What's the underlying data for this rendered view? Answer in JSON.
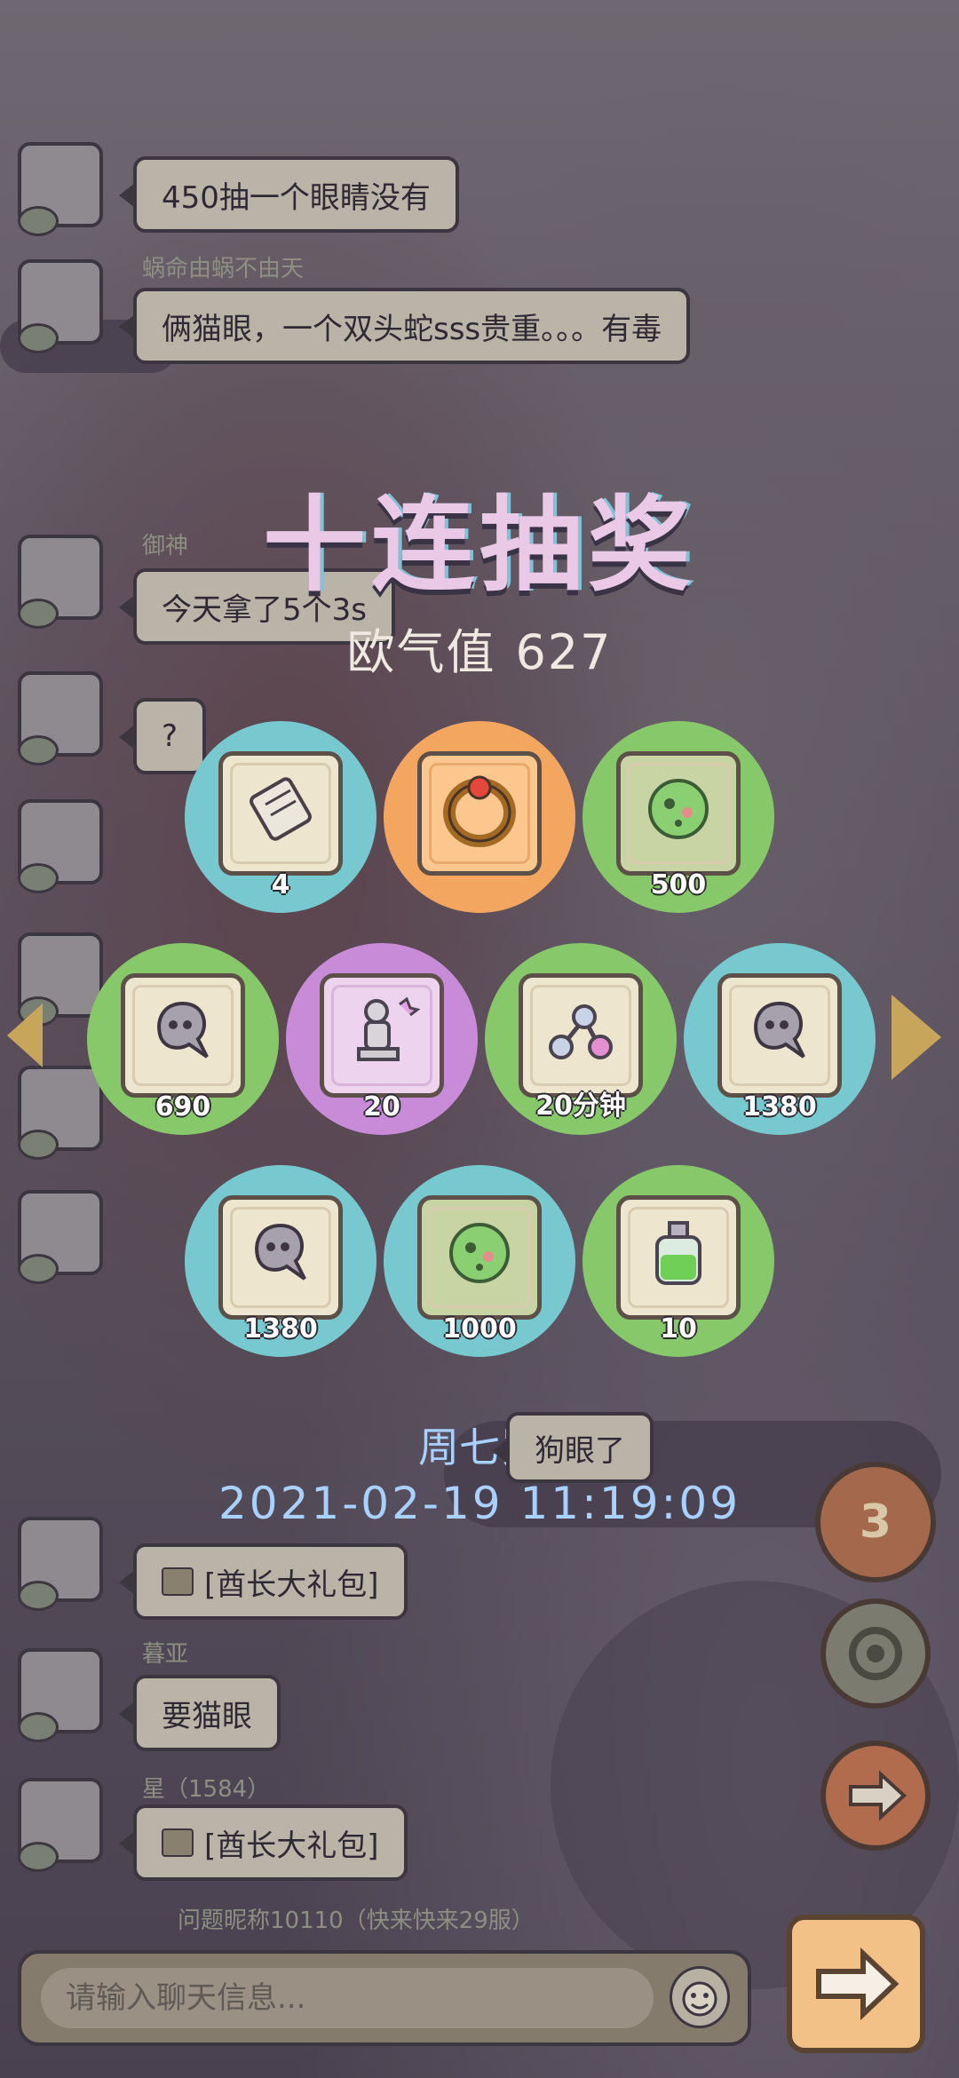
{
  "chat": {
    "messages": [
      {
        "text": "450抽一个眼睛没有"
      },
      {
        "name": "蜗命由蜗不由天",
        "text": "俩猫眼，一个双头蛇sss贵重。。。有毒"
      },
      {
        "name": "御神",
        "text": "今天拿了5个3s"
      },
      {
        "text": "?"
      },
      {
        "text": "[酋长大礼包]"
      },
      {
        "name": "暮亚",
        "text": "要猫眼"
      },
      {
        "name": "星（1584）",
        "text": "[酋长大礼包]"
      }
    ],
    "footer_name": "问题昵称10110（快来快来29服）"
  },
  "lottery": {
    "title": "十连抽奖",
    "luck_label": "欧气值",
    "luck_value": "627",
    "prizes": [
      {
        "item": "scroll-icon",
        "count": "4",
        "color": "cyan"
      },
      {
        "item": "ring-icon",
        "count": "",
        "color": "orange"
      },
      {
        "item": "spore-icon",
        "count": "500",
        "color": "green"
      },
      {
        "item": "ghost-icon",
        "count": "690",
        "color": "green"
      },
      {
        "item": "statue-icon",
        "count": "20",
        "color": "purple"
      },
      {
        "item": "molecule-icon",
        "count": "20分钟",
        "color": "green"
      },
      {
        "item": "ghost-icon",
        "count": "1380",
        "color": "cyan"
      },
      {
        "item": "ghost-icon",
        "count": "1380",
        "color": "cyan"
      },
      {
        "item": "spore-icon",
        "count": "1000",
        "color": "cyan"
      },
      {
        "item": "potion-icon",
        "count": "10",
        "color": "green"
      }
    ],
    "winner": "周七岁",
    "winner_msg": "狗眼了",
    "timestamp": "2021-02-19  11:19:09"
  },
  "side": {
    "badge": "3"
  },
  "input": {
    "placeholder": "请输入聊天信息..."
  }
}
